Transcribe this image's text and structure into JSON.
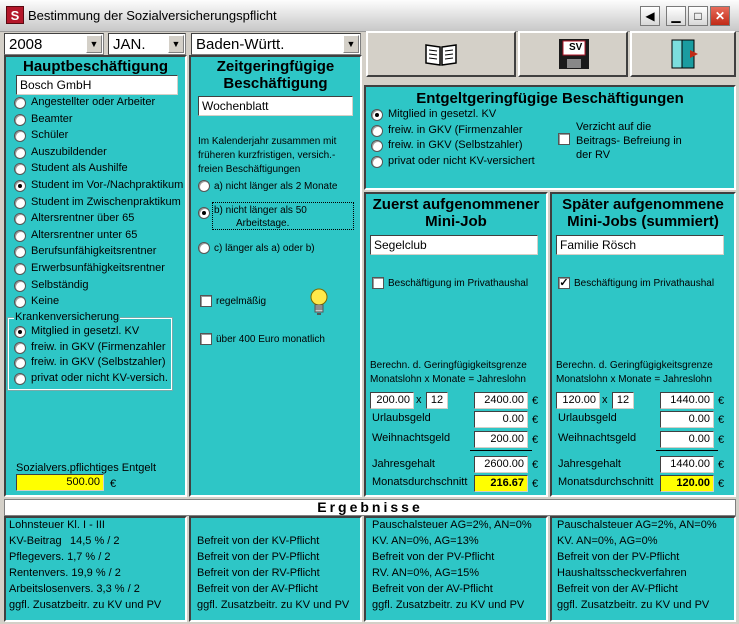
{
  "window": {
    "title": "Bestimmung der Sozialversicherungspflicht",
    "app_icon_letter": "S"
  },
  "selectors": {
    "year": "2008",
    "month": "JAN.",
    "state": "Baden-Württ."
  },
  "toolbar": {
    "floppy_label": "SV"
  },
  "haupt": {
    "heading": "Hauptbeschäftigung",
    "employer": "Bosch GmbH",
    "options": [
      "Angestellter oder Arbeiter",
      "Beamter",
      "Schüler",
      "Auszubildender",
      "Student als Aushilfe",
      "Student im Vor-/Nachpraktikum",
      "Student im Zwischenpraktikum",
      "Altersrentner über 65",
      "Altersrentner unter 65",
      "Berufsunfähigkeitsrentner",
      "Erwerbsunfähigkeitsrentner",
      "Selbständig",
      "Keine"
    ],
    "selected_option": 5,
    "kv_group_label": "Krankenversicherung",
    "kv_options": [
      "Mitglied in gesetzl. KV",
      "freiw. in GKV (Firmenzahler",
      "freiw. in GKV (Selbstzahler)",
      "privat oder nicht KV-versich."
    ],
    "kv_selected": 0,
    "entgelt_label": "Sozialvers.pflichtiges Entgelt",
    "entgelt_value": "500.00",
    "currency": "€"
  },
  "zeit": {
    "heading_line1": "Zeitgeringfügige",
    "heading_line2": "Beschäftigung",
    "employer": "Wochenblatt",
    "text_line1": "Im Kalenderjahr zusammen mit",
    "text_line2": "früheren kurzfristigen, versich.-",
    "text_line3": "freien Beschäftigungen",
    "opt_a": "a)  nicht länger als 2 Monate",
    "opt_b_line1": "b)  nicht länger als 50",
    "opt_b_line2": "Arbeitstage.",
    "opt_c": "c)  länger als a) oder b)",
    "selected": 1,
    "regelmaessig_label": "regelmäßig",
    "regelmaessig_checked": false,
    "ueber400_label": "über 400 Euro monatlich",
    "ueber400_checked": false
  },
  "entgelt": {
    "heading": "Entgeltgeringfügige Beschäftigungen",
    "options": [
      "Mitglied in gesetzl. KV",
      "freiw. in GKV (Firmenzahler",
      "freiw. in GKV (Selbstzahler)",
      "privat oder nicht KV-versichert"
    ],
    "selected": 0,
    "verzicht_line1": "Verzicht auf die",
    "verzicht_line2": "Beitrags- Befreiung in",
    "verzicht_line3": "der RV",
    "verzicht_checked": false
  },
  "minijob1": {
    "heading_line1": "Zuerst aufgenommener",
    "heading_line2": "Mini-Job",
    "employer": "Segelclub",
    "privathaushalt_label": "Beschäftigung im Privathaushal",
    "privathaushalt_checked": false,
    "berechn_line1": "Berechn. d. Geringfügigkeitsgrenze",
    "berechn_line2": "Monatslohn x Monate = Jahreslohn",
    "monatslohn": "200.00",
    "x_sign": "x",
    "monate": "12",
    "jahreslohn": "2400.00",
    "urlaubsgeld_label": "Urlaubsgeld",
    "urlaubsgeld": "0.00",
    "weihnachtsgeld_label": "Weihnachtsgeld",
    "weihnachtsgeld": "200.00",
    "jahresgehalt_label": "Jahresgehalt",
    "jahresgehalt": "2600.00",
    "monatsdurchschnitt_label": "Monatsdurchschnitt",
    "monatsdurchschnitt": "216.67",
    "currency": "€"
  },
  "minijob2": {
    "heading_line1": "Später aufgenommene",
    "heading_line2": "Mini-Jobs (summiert)",
    "employer": "Familie Rösch",
    "privathaushalt_label": "Beschäftigung im Privathaushal",
    "privathaushalt_checked": true,
    "check_mark": "✓",
    "berechn_line1": "Berechn. d. Geringfügigkeitsgrenze",
    "berechn_line2": "Monatslohn x Monate = Jahreslohn",
    "monatslohn": "120.00",
    "x_sign": "x",
    "monate": "12",
    "jahreslohn": "1440.00",
    "urlaubsgeld_label": "Urlaubsgeld",
    "urlaubsgeld": "0.00",
    "weihnachtsgeld_label": "Weihnachtsgeld",
    "weihnachtsgeld": "0.00",
    "jahresgehalt_label": "Jahresgehalt",
    "jahresgehalt": "1440.00",
    "monatsdurchschnitt_label": "Monatsdurchschnitt",
    "monatsdurchschnitt": "120.00",
    "currency": "€"
  },
  "ergebnisse": {
    "heading": "Ergebnisse",
    "col1": [
      "Lohnsteuer Kl. I - III",
      "",
      "Pflegevers. 1,7 % / 2",
      "Rentenvers. 19,9 % / 2",
      "Arbeitslosenvers. 3,3 % / 2",
      "ggfl. Zusatzbeitr. zu KV und PV"
    ],
    "col1_kv_label": "KV-Beitrag",
    "col1_kv_value": "14,5 % / 2",
    "col2": [
      "",
      "Befreit von der KV-Pflicht",
      "Befreit von der PV-Pflicht",
      "Befreit von der RV-Pflicht",
      "Befreit von der AV-Pflicht",
      "ggfl. Zusatzbeitr. zu KV und PV"
    ],
    "col3": [
      "Pauschalsteuer AG=2%, AN=0%",
      "KV. AN=0%, AG=13%",
      "Befreit von der PV-Pflicht",
      "RV. AN=0%, AG=15%",
      "Befreit von der AV-Pflicht",
      "ggfl. Zusatzbeitr. zu KV und PV"
    ],
    "col4": [
      "Pauschalsteuer AG=2%, AN=0%",
      "KV. AN=0%, AG=0%",
      "Befreit von der PV-Pflicht",
      "Haushaltsscheckverfahren",
      "Befreit von der AV-Pflicht",
      "ggfl. Zusatzbeitr. zu KV und PV"
    ]
  }
}
